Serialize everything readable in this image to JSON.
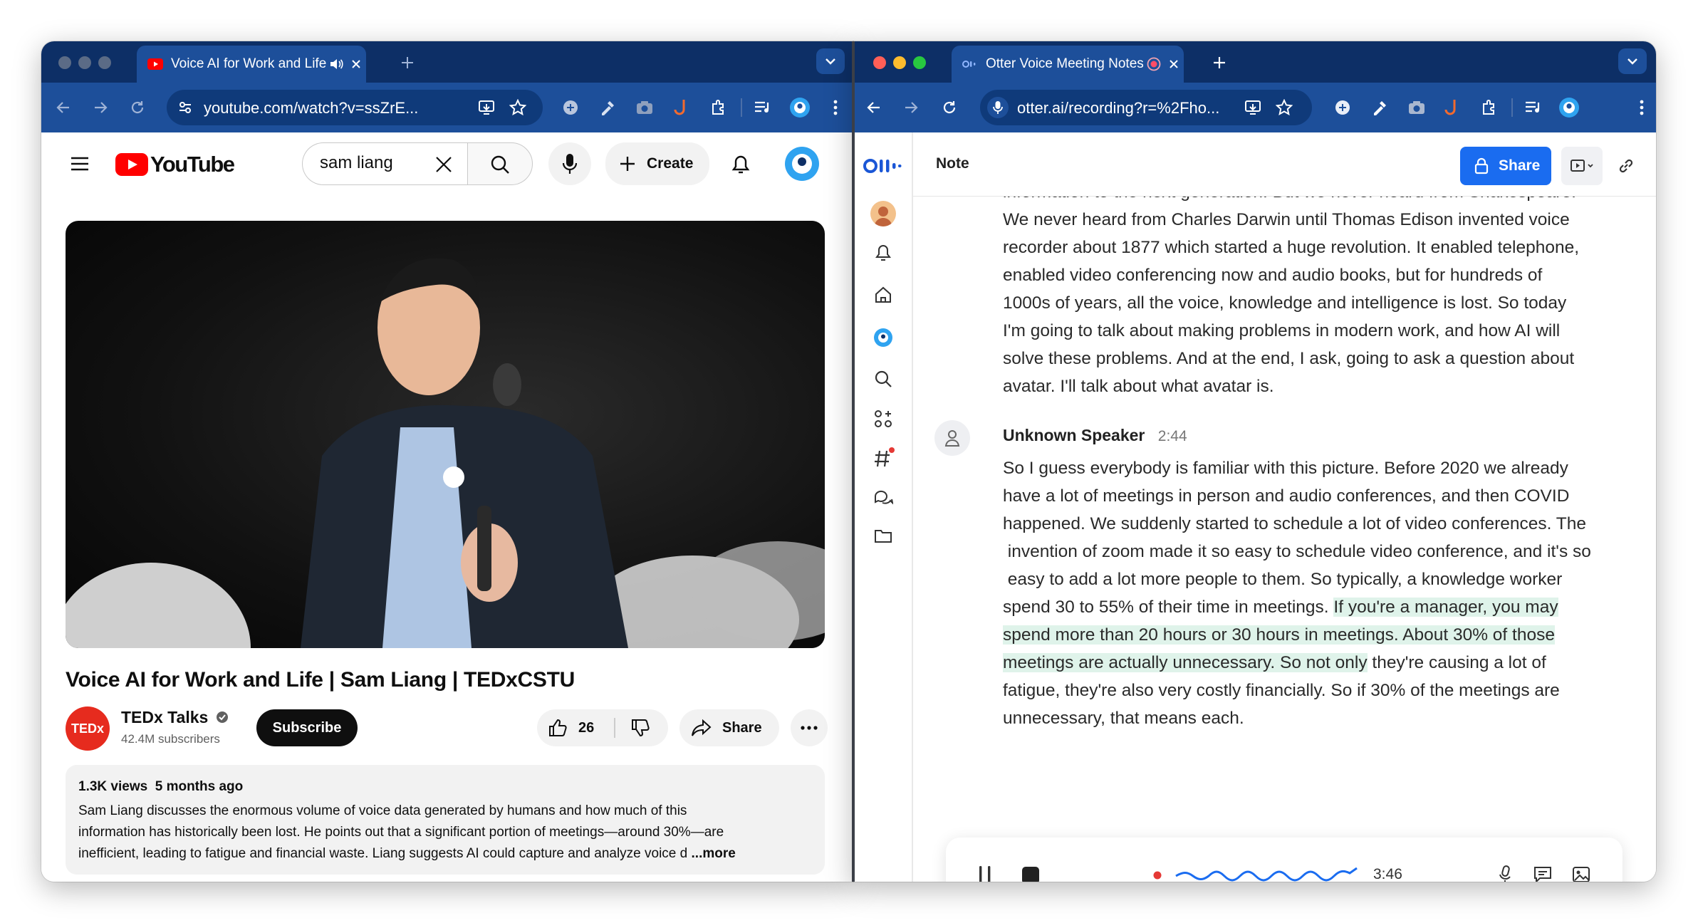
{
  "left_window": {
    "tab": {
      "title": "Voice AI for Work and Life"
    },
    "url": "youtube.com/watch?v=ssZrE...",
    "youtube": {
      "logo_text": "YouTube",
      "search": {
        "value": "sam liang"
      },
      "create_label": "Create",
      "video": {
        "title": "Voice AI for Work and Life | Sam Liang | TEDxCSTU",
        "channel": "TEDx Talks",
        "channel_avatar": "TEDx",
        "subscribers": "42.4M subscribers",
        "subscribe_label": "Subscribe",
        "likes": "26",
        "share_label": "Share"
      },
      "description": {
        "views": "1.3K views",
        "age": "5 months ago",
        "lines": [
          "Sam Liang discusses the enormous volume of voice data generated by humans and how much of this",
          "information has historically been lost. He points out that a significant portion of meetings—around 30%—are",
          "inefficient, leading to fatigue and financial waste. Liang suggests AI could capture and analyze voice d"
        ],
        "more_label": "...more"
      }
    }
  },
  "right_window": {
    "tab": {
      "title": "Otter Voice Meeting Notes"
    },
    "url": "otter.ai/recording?r=%2Fho...",
    "otter": {
      "header_title": "Note",
      "share_label": "Share",
      "transcript": {
        "partial_top": "information to the next generation. But we never heard from Shakespeare.",
        "block1": [
          "We never heard from Charles Darwin until Thomas Edison invented voice",
          "recorder about 1877 which started a huge revolution. It enabled telephone,",
          "enabled video conferencing now and audio books, but for hundreds of",
          "1000s of years, all the voice, knowledge and intelligence is lost. So today",
          "I'm going to talk about making problems in modern work, and how AI will",
          "solve these problems. And at the end, I ask, going to ask a question about",
          "avatar. I'll talk about what avatar is."
        ],
        "speaker": "Unknown Speaker",
        "timestamp": "2:44",
        "block2": [
          {
            "pre": "So I guess everybody is familiar with this picture. Before 2020 we already",
            "hl": "",
            "post": ""
          },
          {
            "pre": "have a lot of meetings in person and audio conferences, and then COVID",
            "hl": "",
            "post": ""
          },
          {
            "pre": "happened. We suddenly started to schedule a lot of video conferences. The",
            "hl": "",
            "post": ""
          },
          {
            "pre": " invention of zoom made it so easy to schedule video conference, and it's so",
            "hl": "",
            "post": ""
          },
          {
            "pre": " easy to add a lot more people to them. So typically, a knowledge worker",
            "hl": "",
            "post": ""
          },
          {
            "pre": "spend 30 to 55% of their time in meetings. ",
            "hl": "If you're a manager, you may",
            "post": ""
          },
          {
            "pre": "",
            "hl": "spend more than 20 hours or 30 hours in meetings. About 30% of those",
            "post": ""
          },
          {
            "pre": "",
            "hl": "meetings are actually unnecessary. So not only",
            "post": " they're causing a lot of"
          },
          {
            "pre": "fatigue, they're also very costly financially. So if 30% of the meetings are",
            "hl": "",
            "post": ""
          },
          {
            "pre": "unnecessary, that means each.",
            "hl": "",
            "post": ""
          }
        ]
      },
      "player": {
        "elapsed": "3:46"
      }
    }
  }
}
